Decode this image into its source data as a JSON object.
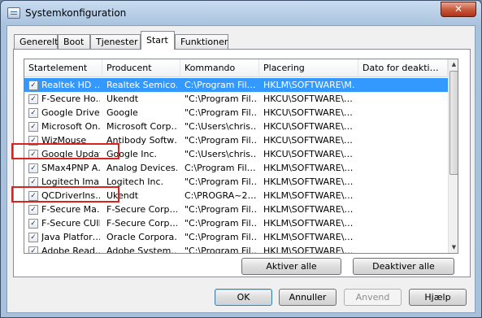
{
  "window": {
    "title": "Systemkonfiguration",
    "close_glyph": "✕"
  },
  "tabs": [
    {
      "label": "Generelt",
      "active": false
    },
    {
      "label": "Boot",
      "active": false
    },
    {
      "label": "Tjenester",
      "active": false
    },
    {
      "label": "Start",
      "active": true
    },
    {
      "label": "Funktioner",
      "active": false
    }
  ],
  "startup_list": {
    "columns": [
      "Startelement",
      "Producent",
      "Kommando",
      "Placering",
      "Dato for deakti…"
    ],
    "rows": [
      {
        "checked": true,
        "selected": true,
        "name": "Realtek HD …",
        "producer": "Realtek Semico…",
        "command": "C:\\Program Fil…",
        "location": "HKLM\\SOFTWARE\\M…"
      },
      {
        "checked": true,
        "selected": false,
        "name": "F-Secure Ho…",
        "producer": "Ukendt",
        "command": "\"C:\\Program Fil…",
        "location": "HKCU\\SOFTWARE\\…"
      },
      {
        "checked": true,
        "selected": false,
        "name": "Google Drive",
        "producer": "Google",
        "command": "\"C:\\Program Fil…",
        "location": "HKCU\\SOFTWARE\\…"
      },
      {
        "checked": true,
        "selected": false,
        "name": "Microsoft On…",
        "producer": "Microsoft Corp…",
        "command": "\"C:\\Users\\chris…",
        "location": "HKCU\\SOFTWARE\\…"
      },
      {
        "checked": true,
        "selected": false,
        "name": "WizMouse",
        "producer": "Antibody Softw…",
        "command": "\"C:\\Program Fil…",
        "location": "HKCU\\SOFTWARE\\…"
      },
      {
        "checked": true,
        "selected": false,
        "name": "Google Update",
        "producer": "Google Inc.",
        "command": "\"C:\\Users\\chris…",
        "location": "HKCU\\SOFTWARE\\…"
      },
      {
        "checked": true,
        "selected": false,
        "name": "SMax4PNP A…",
        "producer": "Analog Devices…",
        "command": "C:\\Program Fil…",
        "location": "HKLM\\SOFTWARE\\…"
      },
      {
        "checked": true,
        "selected": false,
        "name": "Logitech Ima…",
        "producer": "Logitech Inc.",
        "command": "\"C:\\Program Fil…",
        "location": "HKLM\\SOFTWARE\\…"
      },
      {
        "checked": true,
        "selected": false,
        "name": "QCDriverIns…",
        "producer": "Ukendt",
        "command": "C:\\PROGRA~2…",
        "location": "HKLM\\SOFTWARE\\…"
      },
      {
        "checked": true,
        "selected": false,
        "name": "F-Secure Ma…",
        "producer": "F-Secure Corp…",
        "command": "\"C:\\Program Fil…",
        "location": "HKLM\\SOFTWARE\\…"
      },
      {
        "checked": true,
        "selected": false,
        "name": "F-Secure CUIF",
        "producer": "F-Secure Corp…",
        "command": "\"C:\\Program Fil…",
        "location": "HKLM\\SOFTWARE\\…"
      },
      {
        "checked": true,
        "selected": false,
        "name": "Java Platfor…",
        "producer": "Oracle Corpora…",
        "command": "\"C:\\Program Fil…",
        "location": "HKLM\\SOFTWARE\\…"
      },
      {
        "checked": true,
        "selected": false,
        "name": "Adobe Read…",
        "producer": "Adobe System…",
        "command": "\"C:\\Program Fil…",
        "location": "HKLM\\SOFTWARE\\…"
      }
    ]
  },
  "panel_buttons": {
    "enable_all": "Aktiver alle",
    "disable_all": "Deaktiver alle"
  },
  "dialog_buttons": {
    "ok": "OK",
    "cancel": "Annuller",
    "apply": "Anvend",
    "help": "Hjælp"
  },
  "colors": {
    "selection": "#3399ff",
    "annotation": "#d9231f"
  }
}
